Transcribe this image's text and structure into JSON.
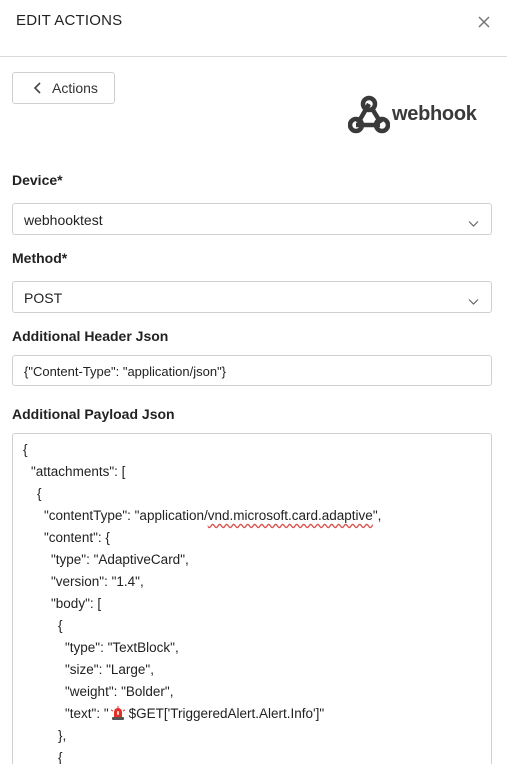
{
  "header": {
    "title": "EDIT ACTIONS",
    "close_icon": "close-icon"
  },
  "back_button": {
    "label": "Actions",
    "icon": "chevron-left-icon"
  },
  "logo": {
    "text": "webhook",
    "icon": "webhook-logo-icon"
  },
  "device": {
    "label": "Device*",
    "value": "webhooktest"
  },
  "method": {
    "label": "Method*",
    "value": "POST"
  },
  "header_json": {
    "label": "Additional Header Json",
    "value": "{\"Content-Type\": \"application/json\"}"
  },
  "payload_json": {
    "label": "Additional Payload Json",
    "lines": {
      "l0": "{",
      "l1": "\"attachments\": [",
      "l2": "{",
      "l3_pre": "\"contentType\": \"application/",
      "l3_mid": "vnd.microsoft.card.adaptive",
      "l3_post": "\",",
      "l4": "\"content\": {",
      "l5": "\"type\": \"AdaptiveCard\",",
      "l6": "\"version\": \"1.4\",",
      "l7": "\"body\": [",
      "l8": "{",
      "l9": "\"type\": \"TextBlock\",",
      "l10": "\"size\": \"Large\",",
      "l11": "\"weight\": \"Bolder\",",
      "l12_pre": "\"text\": \"",
      "l12_post": "$GET['TriggeredAlert.Alert.Info']\"",
      "l13": "},",
      "l14": "{"
    }
  },
  "colors": {
    "border": "#d0d0d0",
    "siren_red": "#e0302a"
  }
}
